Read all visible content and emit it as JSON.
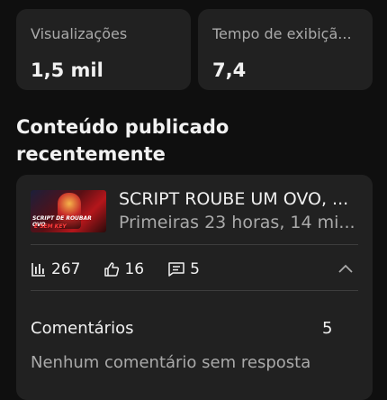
{
  "stats": [
    {
      "label": "Visualizações",
      "value": "1,5 mil"
    },
    {
      "label": "Tempo de exibiçã...",
      "value": "7,4"
    }
  ],
  "section_title": "Conteúdo publicado recentemente",
  "video": {
    "title": "SCRIPT ROUBE UM OVO, ...",
    "subtitle": "Primeiras 23 horas, 14 mi...",
    "thumbnail_text_1": "SCRIPT DE ROUBAR OVO",
    "thumbnail_text_2": "E SEM KEY"
  },
  "metrics": {
    "views": "267",
    "likes": "16",
    "comments": "5"
  },
  "icons": [
    "bar-chart-icon",
    "thumbs-up-icon",
    "comment-icon",
    "chevron-up-icon"
  ],
  "comments": {
    "label": "Comentários",
    "count": "5",
    "empty_text": "Nenhum comentário sem resposta"
  },
  "colors": {
    "background": "#0f0f0f",
    "card": "#212121",
    "text_primary": "#f1f1f1",
    "text_secondary": "#aaaaaa"
  }
}
